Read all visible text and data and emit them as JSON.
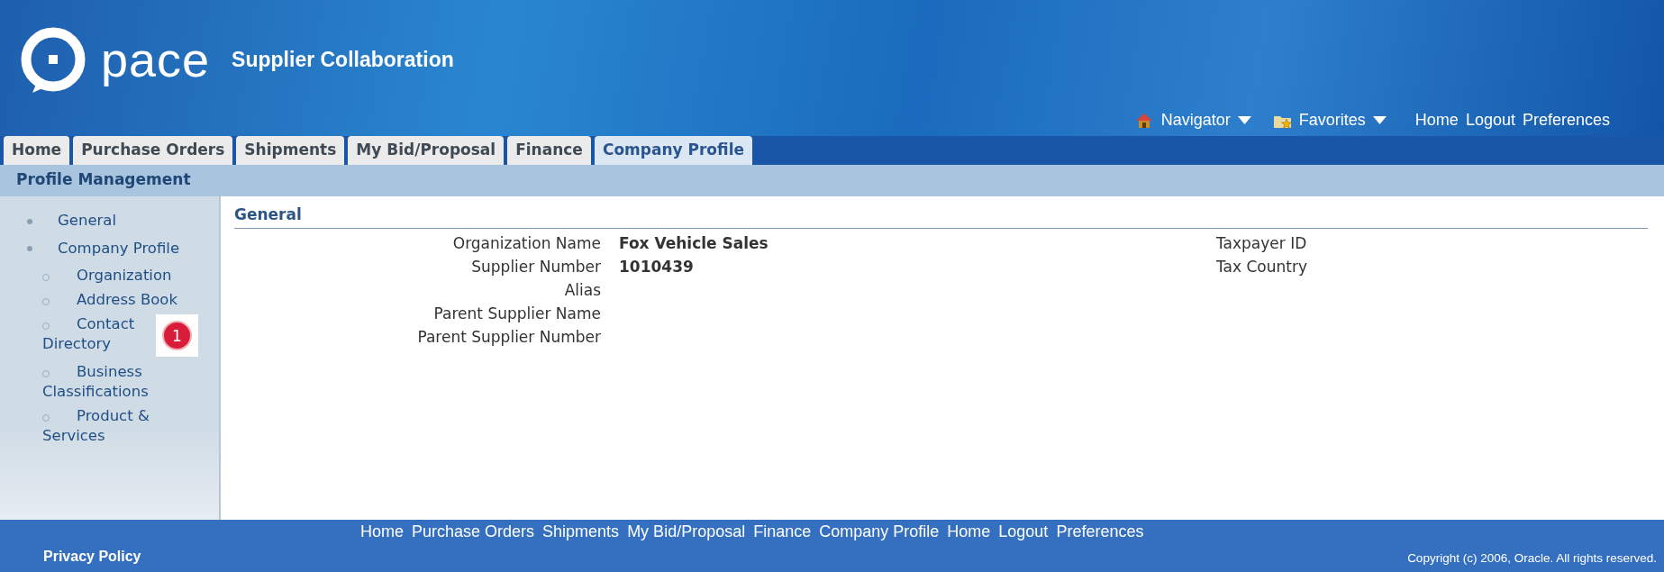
{
  "header": {
    "logo_text": "pace",
    "app_title": "Supplier Collaboration",
    "menus": [
      {
        "label": "Navigator",
        "kind": "navigator"
      },
      {
        "label": "Favorites",
        "kind": "favorites"
      }
    ],
    "global_links": [
      "Home",
      "Logout",
      "Preferences"
    ]
  },
  "tabs": [
    {
      "label": "Home",
      "selected": false
    },
    {
      "label": "Purchase Orders",
      "selected": false
    },
    {
      "label": "Shipments",
      "selected": false
    },
    {
      "label": "My Bid/Proposal",
      "selected": false
    },
    {
      "label": "Finance",
      "selected": false
    },
    {
      "label": "Company Profile",
      "selected": true
    }
  ],
  "subtab_bar": {
    "title": "Profile Management"
  },
  "sidebar": {
    "items": [
      {
        "label": "General"
      },
      {
        "label": "Company Profile",
        "children": [
          {
            "label": "Organization"
          },
          {
            "label": "Address Book"
          },
          {
            "label": "Contact Directory",
            "callout": "1"
          },
          {
            "label": "Business Classifications"
          },
          {
            "label": "Product & Services"
          }
        ]
      }
    ]
  },
  "section": {
    "title": "General",
    "left_fields": [
      {
        "label": "Organization Name",
        "value": "Fox Vehicle Sales"
      },
      {
        "label": "Supplier Number",
        "value": "1010439"
      },
      {
        "label": "Alias"
      },
      {
        "label": "Parent Supplier Name"
      },
      {
        "label": "Parent Supplier Number"
      }
    ],
    "right_fields": [
      {
        "label": "Taxpayer ID"
      },
      {
        "label": "Tax Country"
      }
    ]
  },
  "footer": {
    "links": [
      "Home",
      "Purchase Orders",
      "Shipments",
      "My Bid/Proposal",
      "Finance",
      "Company Profile",
      "Home",
      "Logout",
      "Preferences"
    ],
    "privacy": "Privacy Policy",
    "copyright": "Copyright (c) 2006, Oracle. All rights reserved."
  }
}
